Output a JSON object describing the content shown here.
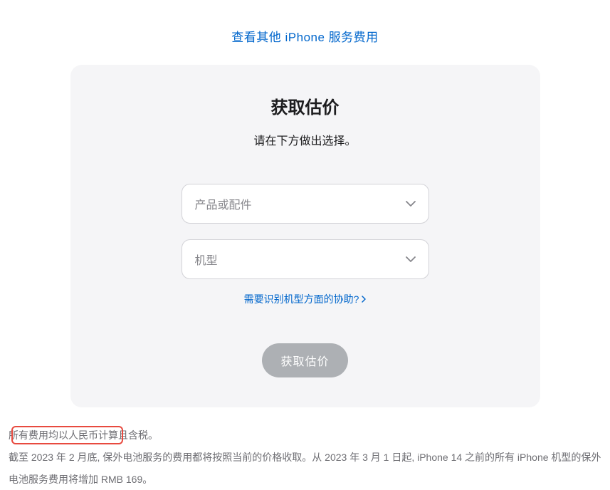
{
  "topLink": {
    "label": "查看其他 iPhone 服务费用"
  },
  "card": {
    "title": "获取估价",
    "subtitle": "请在下方做出选择。",
    "select1": {
      "placeholder": "产品或配件"
    },
    "select2": {
      "placeholder": "机型"
    },
    "helpLink": {
      "label": "需要识别机型方面的协助?"
    },
    "button": {
      "label": "获取估价"
    }
  },
  "footer": {
    "line1": "所有费用均以人民币计算且含税。",
    "line2": "截至 2023 年 2 月底, 保外电池服务的费用都将按照当前的价格收取。从 2023 年 3 月 1 日起, iPhone 14 之前的所有 iPhone 机型的保外电池服务费用将增加 RMB 169。"
  }
}
